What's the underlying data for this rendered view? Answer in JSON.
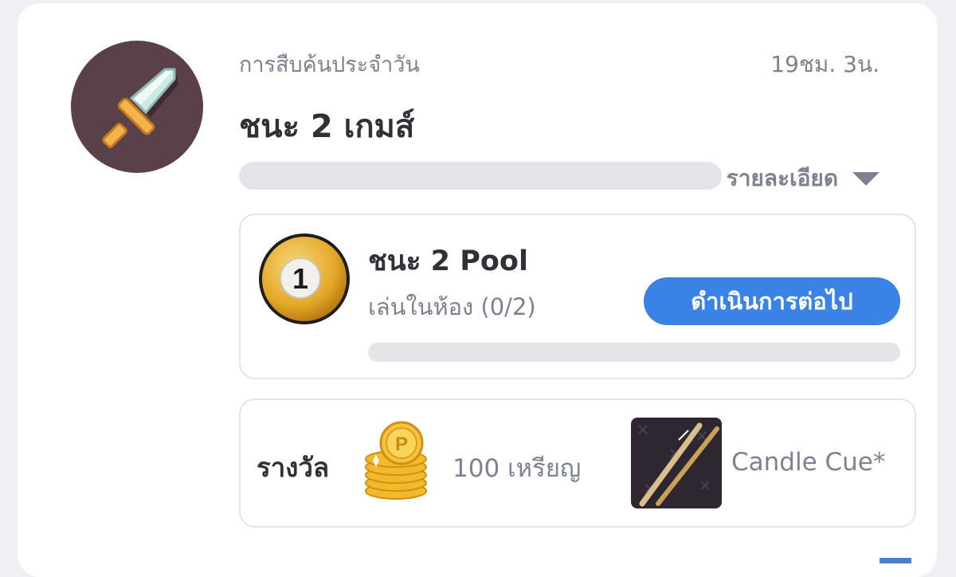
{
  "quest": {
    "category": "การสืบค้นประจำวัน",
    "timer": "19ชม. 3น.",
    "title": "ชนะ 2 เกมส์",
    "progress": 0,
    "details_label": "รายละเอียด",
    "icon": "sword-icon"
  },
  "task": {
    "title": "ชนะ 2 Pool",
    "subtitle": "เล่นในห้อง (0/2)",
    "button_label": "ดำเนินการต่อไป",
    "progress": 0,
    "icon": "pool-ball-1-icon",
    "ball_number": "1"
  },
  "reward": {
    "label": "รางวัล",
    "items": [
      {
        "icon": "coin-stack-icon",
        "label": "100 เหรียญ"
      },
      {
        "icon": "candle-cue-thumbnail",
        "label": "Candle Cue*"
      }
    ]
  },
  "colors": {
    "accent": "#3b82e6",
    "progress_track": "#e4e5e9",
    "icon_bg": "#5a4048"
  }
}
